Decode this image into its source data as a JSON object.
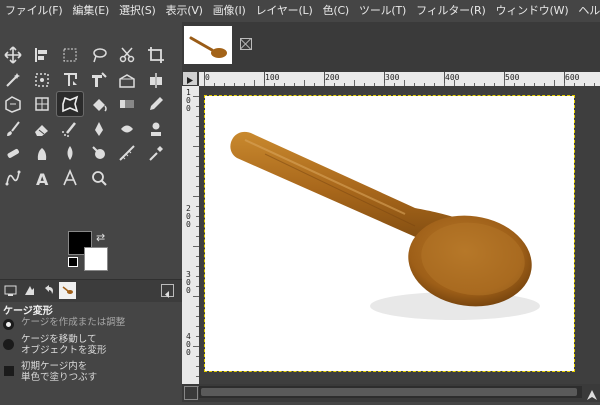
{
  "menubar": {
    "items": [
      "ファイル(F)",
      "編集(E)",
      "選択(S)",
      "表示(V)",
      "画像(I)",
      "レイヤー(L)",
      "色(C)",
      "ツール(T)",
      "フィルター(R)",
      "ウィンドウ(W)",
      "ヘルプ(H)"
    ]
  },
  "toolbox": {
    "tools": [
      "move",
      "align",
      "free-select",
      "lasso",
      "scissors",
      "crop",
      "fuzzy-select",
      "clone",
      "rotate",
      "text-transform",
      "perspective",
      "flip",
      "warp",
      "foreground-select",
      "cage-transform",
      "bucket-fill",
      "blend",
      "pencil",
      "paintbrush",
      "eraser",
      "airbrush",
      "ink",
      "mypaint",
      "clone-stamp",
      "heal",
      "smudge",
      "dodge",
      "blur",
      "measure",
      "color-picker",
      "path",
      "text",
      "paths",
      "zoom"
    ],
    "active_tool": "cage-transform"
  },
  "colors": {
    "foreground": "#000000",
    "background": "#ffffff",
    "accent": "#e6d000",
    "panel": "#454545"
  },
  "dock_tabs": [
    "tool-options",
    "device-status",
    "undo-history",
    "images"
  ],
  "tool_options": {
    "title": "ケージ変形",
    "radio_create": "ケージを作成または調整",
    "radio_move_line1": "ケージを移動して",
    "radio_move_line2": "オブジェクトを変形",
    "check_fill_line1": "初期ケージ内を",
    "check_fill_line2": "単色で塗りつぶす"
  },
  "ruler": {
    "h_labels": [
      "0",
      "100",
      "200",
      "300",
      "400",
      "500",
      "600"
    ],
    "v_labels": [
      "1",
      "0",
      "0",
      "2",
      "0",
      "0",
      "3",
      "0",
      "0",
      "4",
      "0",
      "0"
    ]
  },
  "image": {
    "name": "wooden-spoon"
  }
}
